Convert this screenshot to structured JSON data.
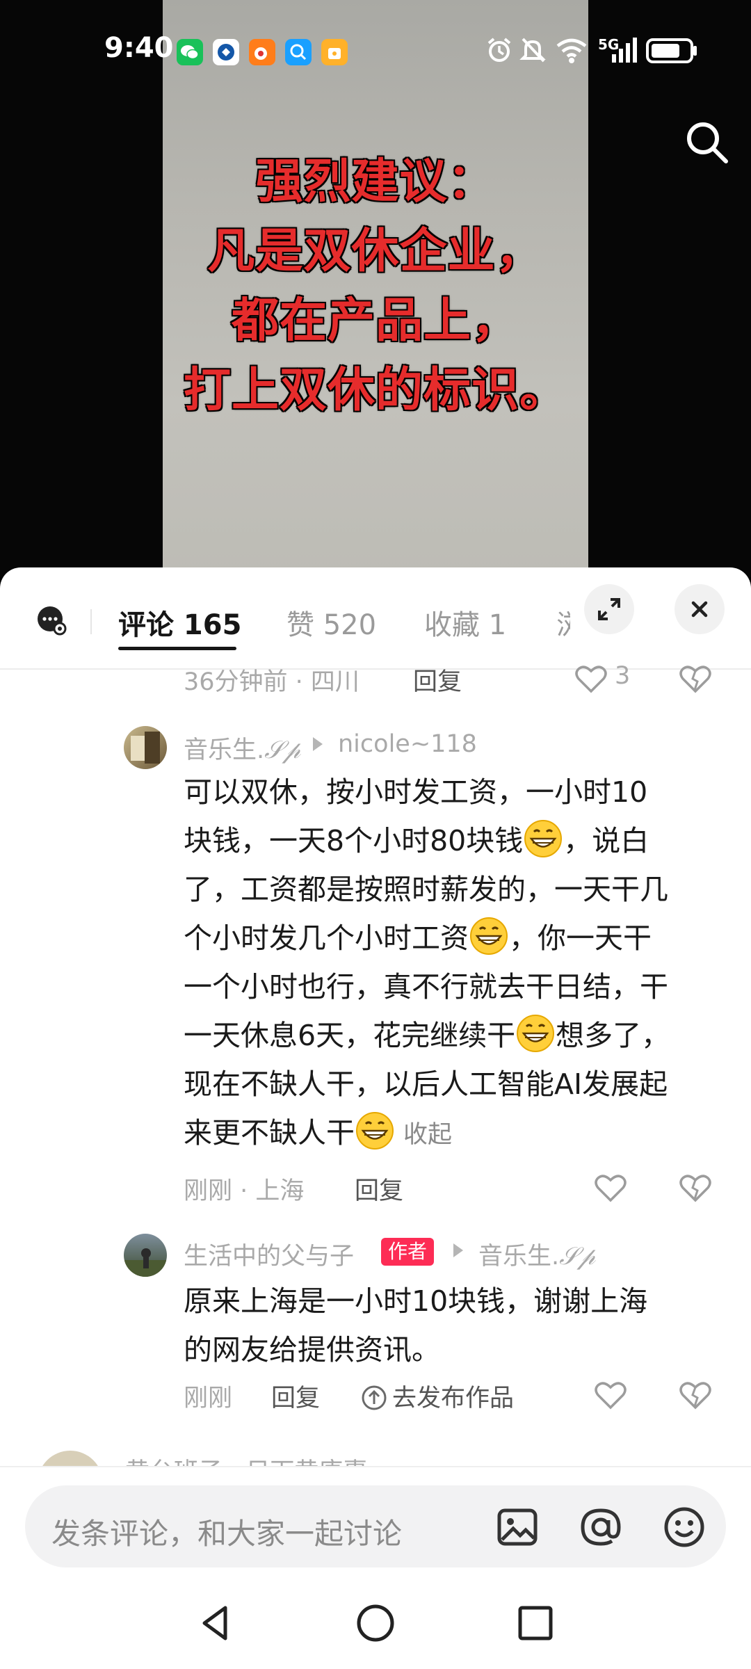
{
  "status_bar": {
    "time": "9:40",
    "network": "5G"
  },
  "video": {
    "overlay_lines": [
      "强烈建议：",
      "凡是双休企业，",
      "都在产品上，",
      "打上双休的标识。"
    ]
  },
  "tabs": {
    "comments": "评论 165",
    "likes": "赞 520",
    "favorites": "收藏 1",
    "more": "浏"
  },
  "comments": {
    "prev_meta": {
      "time": "36分钟前 · 四川",
      "reply": "回复",
      "likes": "3"
    },
    "c1": {
      "author": "音乐生.",
      "author_sig": "𝒮𝓅",
      "reply_to": "nicole~118",
      "line1": "可以双休，按小时发工资，一小时10",
      "line2a": "块钱，一天8个小时80块钱",
      "line2b": "，说白",
      "line3": "了，工资都是按照时薪发的，一天干几",
      "line4a": "个小时发几个小时工资",
      "line4b": "，你一天干",
      "line5": "一个小时也行，真不行就去干日结，干",
      "line6a": "一天休息6天，花完继续干",
      "line6b": "想多了，",
      "line7": "现在不缺人干，以后人工智能AI发展起",
      "line8a": "来更不缺人干",
      "collapse": "收起",
      "time": "刚刚 · 上海",
      "reply": "回复"
    },
    "c2": {
      "author": "生活中的父与子",
      "tag": "作者",
      "reply_to": "音乐生.",
      "reply_to_sig": "𝒮𝓅",
      "line1": "原来上海是一小时10块钱，谢谢上海",
      "line2": "的网友给提供资讯。",
      "time": "刚刚",
      "reply": "回复",
      "publish": "去发布作品"
    },
    "next_partial": "黄台班子 · 日下黄唐惠"
  },
  "input": {
    "placeholder": "发条评论，和大家一起讨论"
  },
  "colors": {
    "accent": "#fd2c55",
    "overlay_text": "#e62c2c"
  }
}
